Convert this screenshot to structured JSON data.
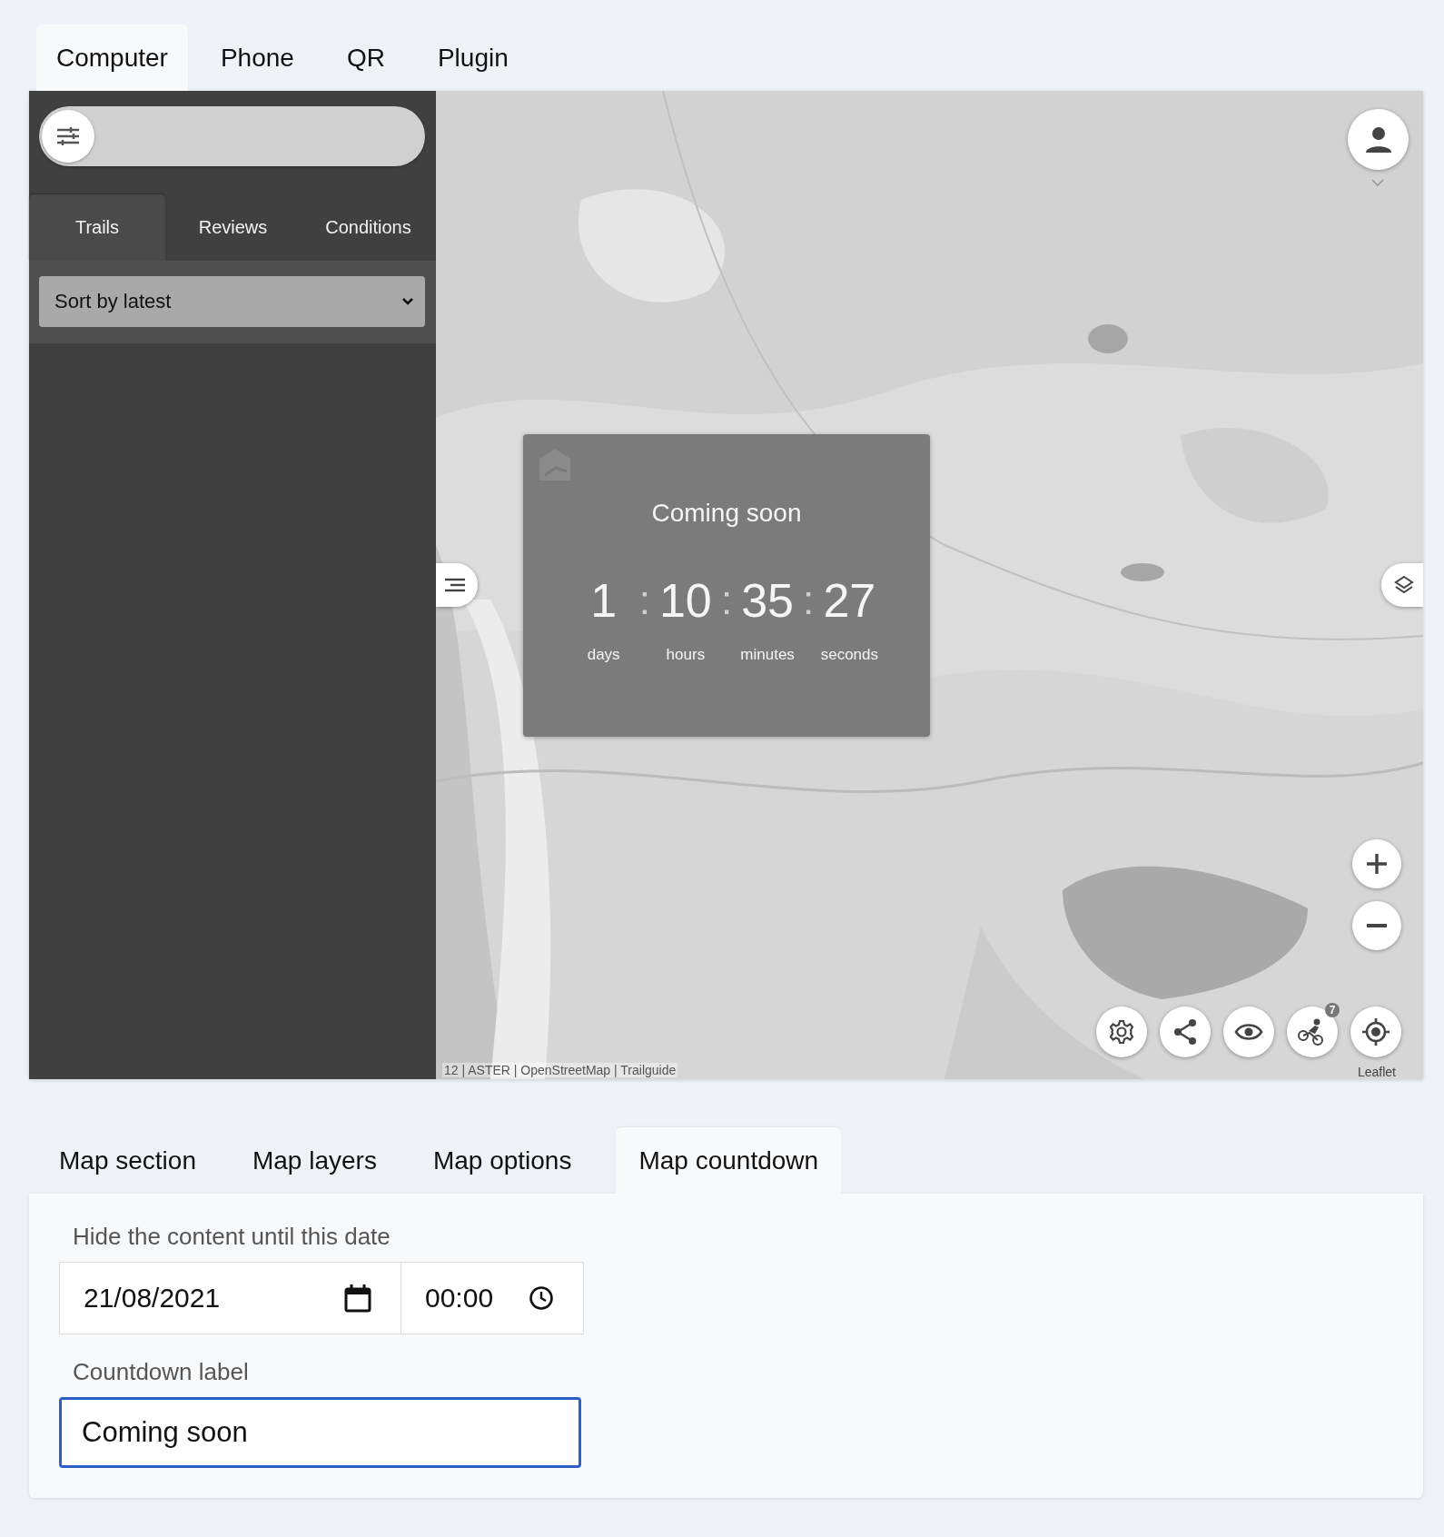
{
  "top_tabs": [
    {
      "label": "Computer",
      "selected": true
    },
    {
      "label": "Phone",
      "selected": false
    },
    {
      "label": "QR",
      "selected": false
    },
    {
      "label": "Plugin",
      "selected": false
    }
  ],
  "sidebar": {
    "tabs": [
      {
        "label": "Trails",
        "selected": true
      },
      {
        "label": "Reviews",
        "selected": false
      },
      {
        "label": "Conditions",
        "selected": false
      }
    ],
    "sort": {
      "value": "Sort by latest"
    }
  },
  "map": {
    "countdown": {
      "label": "Coming soon",
      "units": [
        {
          "value": "1",
          "unit": "days",
          "separator": ":"
        },
        {
          "value": "10",
          "unit": "hours",
          "separator": ":"
        },
        {
          "value": "35",
          "unit": "minutes",
          "separator": ":"
        },
        {
          "value": "27",
          "unit": "seconds"
        }
      ]
    },
    "badge": "7",
    "attribution": "12 | ASTER | OpenStreetMap | Trailguide",
    "credit": "Leaflet"
  },
  "settings_tabs": [
    {
      "label": "Map section",
      "selected": false
    },
    {
      "label": "Map layers",
      "selected": false
    },
    {
      "label": "Map options",
      "selected": false
    },
    {
      "label": "Map countdown",
      "selected": true
    }
  ],
  "form": {
    "date_label": "Hide the content until this date",
    "date": "21/08/2021",
    "time": "00:00",
    "text_label": "Countdown label",
    "text": "Coming soon",
    "focused": true
  }
}
